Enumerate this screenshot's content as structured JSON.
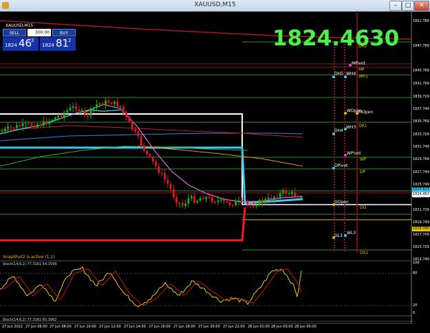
{
  "window": {
    "title": "XAUUSD,M15",
    "controls": {
      "minimize": "–",
      "maximize": "□",
      "close": "✕"
    }
  },
  "chart": {
    "symbol_label": "XAUUSD,M15",
    "current_price_big": "1824.4630",
    "snapshot_text": "SnapShot2 is active (1,1)",
    "stoch_label": "Stoch(14,6,2) 77.3161 54.1599",
    "stoch2_label": "Stoch(14,6,2) 77.3161 65.3962",
    "colors": {
      "background": "#000000",
      "bull": "#19b019",
      "bear": "#e01a1a",
      "big_price": "#4cf04c"
    }
  },
  "trade_panel": {
    "sell_label": "SELL",
    "buy_label": "BUY",
    "lot": "300.00",
    "sell_small": "1824",
    "sell_big": "46",
    "sell_sup": "3",
    "buy_small": "1824",
    "buy_big": "81",
    "buy_sup": "2"
  },
  "levels": [
    {
      "label": "DR2",
      "color": "#e8c400"
    },
    {
      "label": "MPivot",
      "color": "#ffffff"
    },
    {
      "label": "MP",
      "color": "#e8c400"
    },
    {
      "label": "DH5",
      "color": "#ffffff"
    },
    {
      "label": "WH4",
      "color": "#ffffff"
    },
    {
      "label": "WR1",
      "color": "#e8c400"
    },
    {
      "label": "WOpen",
      "color": "#ffffff"
    },
    {
      "label": "MOpen",
      "color": "#ffffff"
    },
    {
      "label": "DR1",
      "color": "#e8c400"
    },
    {
      "label": "DH4",
      "color": "#ffffff"
    },
    {
      "label": "WH3",
      "color": "#ffffff"
    },
    {
      "label": "WPivot",
      "color": "#ffffff"
    },
    {
      "label": "WP",
      "color": "#e8c400"
    },
    {
      "label": "DPivot",
      "color": "#ffffff"
    },
    {
      "label": "DP",
      "color": "#e8c400"
    },
    {
      "label": "DOpen",
      "color": "#ffffff"
    },
    {
      "label": "DO",
      "color": "#e8c400"
    },
    {
      "label": "DL3",
      "color": "#ffffff"
    },
    {
      "label": "WL3",
      "color": "#ffffff"
    },
    {
      "label": "DS1",
      "color": "#e8c400"
    }
  ],
  "price_axis": [
    "1851.789",
    "1847.769",
    "1843.769",
    "1841.769",
    "1839.729",
    "1837.749",
    "1835.769",
    "1833.729",
    "1831.749",
    "1829.769",
    "1827.749",
    "1825.749",
    "1823.709",
    "1821.729",
    "1819.749",
    "1817.709",
    "1815.729",
    "1813.749"
  ],
  "price_boxes": [
    {
      "text": "1824.625",
      "color": "#3cc8f0"
    },
    {
      "text": "1824.463",
      "color": "#ffffff"
    },
    {
      "text": "1818.080",
      "color": "#e8c400"
    }
  ],
  "stoch_axis": [
    "100",
    "80",
    "20",
    "0"
  ],
  "time_axis": [
    "27 Jun 2022",
    "27 Jun 06:00",
    "27 Jun 08:00",
    "27 Jun 10:00",
    "27 Jun 12:00",
    "27 Jun 14:00",
    "27 Jun 16:00",
    "27 Jun 18:00",
    "27 Jun 20:00",
    "27 Jun 22:00",
    "28 Jun 01:00",
    "28 Jun 03:00",
    "28 Jun 05:00"
  ]
}
